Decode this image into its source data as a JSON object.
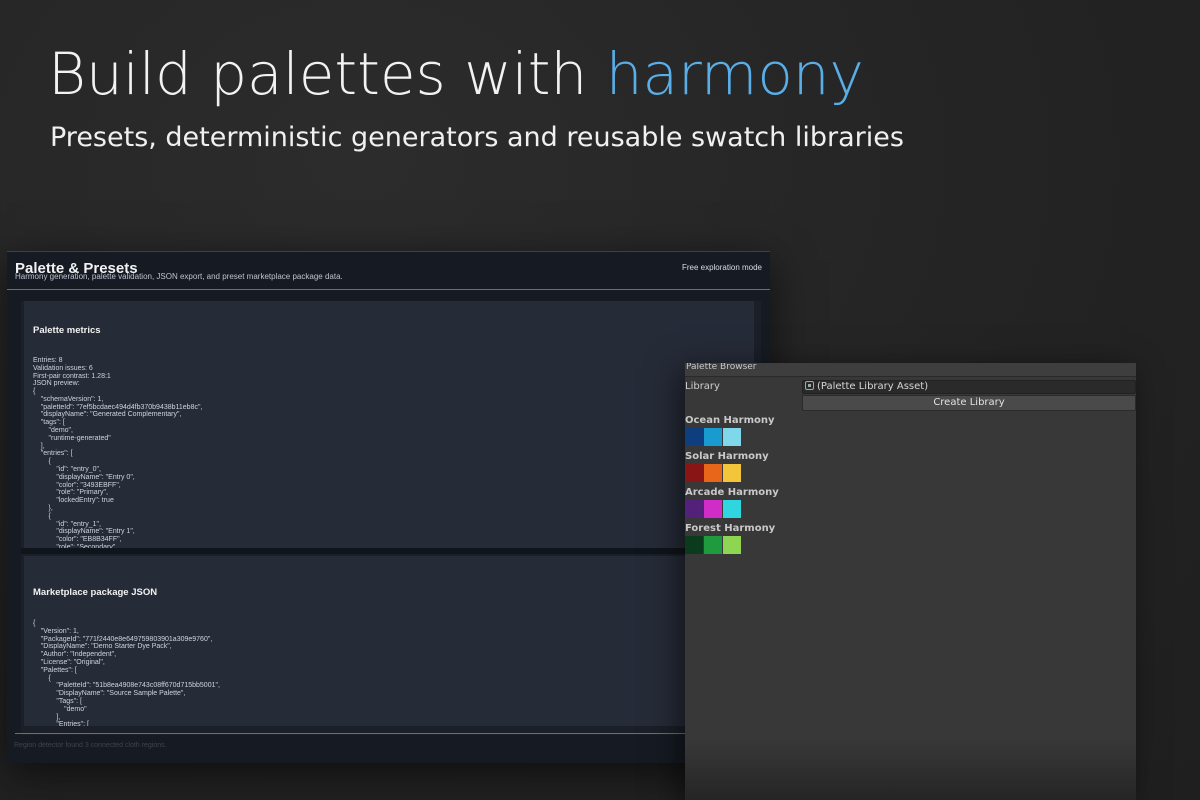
{
  "hero": {
    "title_main": "Build palettes with ",
    "title_accent": "harmony",
    "subtitle": "Presets, deterministic generators and reusable swatch libraries"
  },
  "left_window": {
    "title": "Palette & Presets",
    "description": "Harmony generation, palette validation, JSON export, and preset marketplace package data.",
    "mode": "Free exploration mode",
    "metrics_panel": {
      "heading": "Palette metrics",
      "entries": "Entries: 8",
      "validation": "Validation issues: 6",
      "contrast": "First-pair contrast: 1.28:1",
      "json_label": "JSON preview:",
      "json": "{\n    \"schemaVersion\": 1,\n    \"paletteId\": \"7ef5bcdaec494d4fb370b9438b11eb8c\",\n    \"displayName\": \"Generated Complementary\",\n    \"tags\": [\n        \"demo\",\n        \"runtime-generated\"\n    ],\n    \"entries\": [\n        {\n            \"id\": \"entry_0\",\n            \"displayName\": \"Entry 0\",\n            \"color\": \"3493EBFF\",\n            \"role\": \"Primary\",\n            \"lockedEntry\": true\n        },\n        {\n            \"id\": \"entry_1\",\n            \"displayName\": \"Entry 1\",\n            \"color\": \"EB8B34FF\",\n            \"role\": \"Secondary\","
    },
    "marketplace_panel": {
      "heading": "Marketplace package JSON",
      "json": "{\n    \"Version\": 1,\n    \"PackageId\": \"771f2440e8e649759803901a309e9760\",\n    \"DisplayName\": \"Demo Starter Dye Pack\",\n    \"Author\": \"Independent\",\n    \"License\": \"Original\",\n    \"Palettes\": [\n        {\n            \"PaletteId\": \"51b8ea4908e743c08ff670d715bb5001\",\n            \"DisplayName\": \"Source Sample Palette\",\n            \"Tags\": [\n                \"demo\"\n            ],\n            \"Entries\": ["
    },
    "footer": "Region detector found 3 connected cloth regions."
  },
  "right_window": {
    "title": "Palette Browser",
    "library_label": "Library",
    "library_value": "(Palette Library Asset)",
    "create_button": "Create Library",
    "palettes": [
      {
        "name": "Ocean Harmony",
        "colors": [
          "#0f3e7e",
          "#1a9bd0",
          "#7fd8ea"
        ]
      },
      {
        "name": "Solar Harmony",
        "colors": [
          "#8a1515",
          "#e8661a",
          "#f2c53a"
        ]
      },
      {
        "name": "Arcade Harmony",
        "colors": [
          "#53207a",
          "#d02cc8",
          "#2fd6e0"
        ]
      },
      {
        "name": "Forest Harmony",
        "colors": [
          "#0c3a1c",
          "#1f9a3e",
          "#8ed652"
        ]
      }
    ]
  }
}
